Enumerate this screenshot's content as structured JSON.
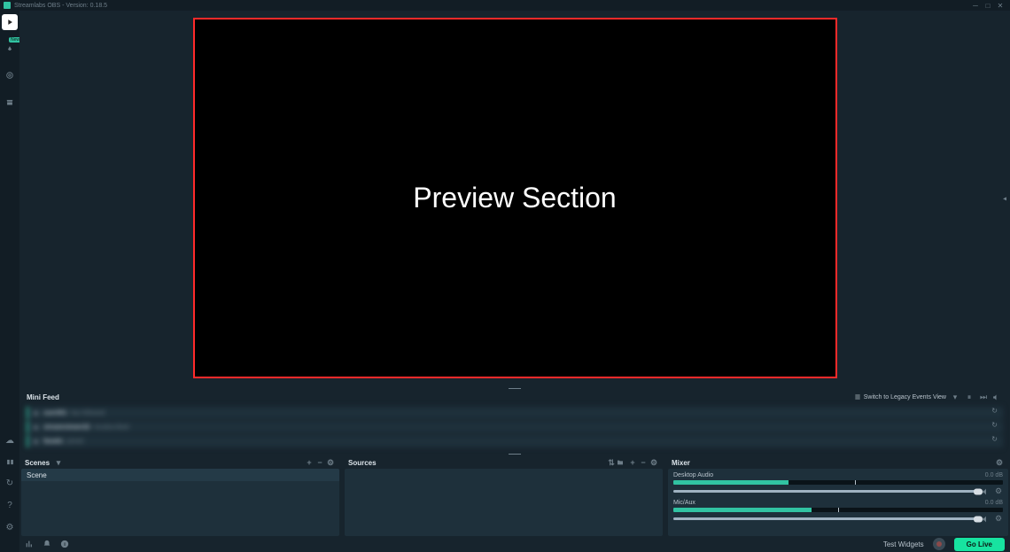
{
  "titlebar": {
    "title": "Streamlabs OBS - Version: 0.18.5"
  },
  "sidebar": {
    "tabs": [
      {
        "name": "editor",
        "badge": ""
      },
      {
        "name": "themes",
        "badge": "New"
      },
      {
        "name": "dashboard",
        "badge": ""
      },
      {
        "name": "store",
        "badge": ""
      }
    ]
  },
  "preview": {
    "label": "Preview Section"
  },
  "minifeed": {
    "title": "Mini Feed",
    "switch_link": "Switch to Legacy Events View",
    "items": [
      {
        "name": "user001",
        "subtext": "has followed"
      },
      {
        "name": "streamviewer22",
        "subtext": "resubscribed"
      },
      {
        "name": "fanatic",
        "subtext": "joined"
      }
    ]
  },
  "panels": {
    "scenes": {
      "title": "Scenes",
      "items": [
        "Scene"
      ]
    },
    "sources": {
      "title": "Sources"
    },
    "mixer": {
      "title": "Mixer",
      "tracks": [
        {
          "name": "Desktop Audio",
          "db": "0.0 dB",
          "level": 35,
          "slider": 100
        },
        {
          "name": "Mic/Aux",
          "db": "0.0 dB",
          "level": 42,
          "slider": 100
        }
      ]
    }
  },
  "footer": {
    "test_widgets": "Test Widgets",
    "go_live": "Go Live"
  }
}
